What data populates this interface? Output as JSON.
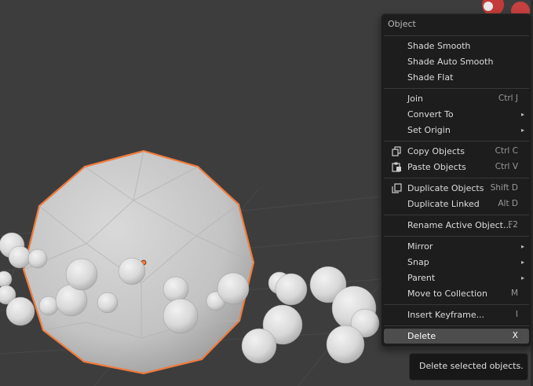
{
  "menu": {
    "title": "Object",
    "items": [
      {
        "label": "Shade Smooth"
      },
      {
        "label": "Shade Auto Smooth"
      },
      {
        "label": "Shade Flat"
      },
      {
        "label": "Join",
        "shortcut": "Ctrl J"
      },
      {
        "label": "Convert To",
        "submenu": "▸"
      },
      {
        "label": "Set Origin",
        "submenu": "▸"
      },
      {
        "label": "Copy Objects",
        "shortcut": "Ctrl C",
        "icon": "copy-icon"
      },
      {
        "label": "Paste Objects",
        "shortcut": "Ctrl V",
        "icon": "paste-icon"
      },
      {
        "label": "Duplicate Objects",
        "shortcut": "Shift D",
        "icon": "duplicate-icon"
      },
      {
        "label": "Duplicate Linked",
        "shortcut": "Alt D"
      },
      {
        "label": "Rename Active Object...",
        "shortcut": "F2"
      },
      {
        "label": "Mirror",
        "submenu": "▸"
      },
      {
        "label": "Snap",
        "submenu": "▸"
      },
      {
        "label": "Parent",
        "submenu": "▸"
      },
      {
        "label": "Move to Collection",
        "shortcut": "M"
      },
      {
        "label": "Insert Keyframe...",
        "shortcut": "I"
      },
      {
        "label": "Delete",
        "shortcut": "X",
        "active": true
      }
    ]
  },
  "tooltip": {
    "text": "Delete selected objects."
  },
  "colors": {
    "viewport_bg": "#3d3d3d",
    "selection_outline": "#f07a3c",
    "menu_bg": "#1d1d1d",
    "highlight_bg": "#4d4d4d"
  }
}
